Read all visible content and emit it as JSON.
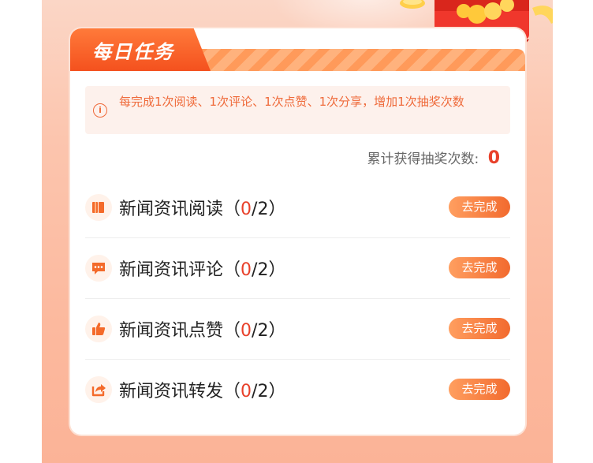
{
  "card": {
    "title": "每日任务",
    "notice": "每完成1次阅读、1次评论、1次点赞、1次分享，增加1次抽奖次数",
    "total_label": "累计获得抽奖次数:",
    "total_value": "0"
  },
  "tasks": [
    {
      "icon": "book-icon",
      "name": "新闻资讯阅读",
      "open": "（",
      "done": "0",
      "rest": "/2）",
      "button": "去完成"
    },
    {
      "icon": "comment-icon",
      "name": "新闻资讯评论",
      "open": "（",
      "done": "0",
      "rest": "/2）",
      "button": "去完成"
    },
    {
      "icon": "thumbs-up-icon",
      "name": "新闻资讯点赞",
      "open": "（",
      "done": "0",
      "rest": "/2）",
      "button": "去完成"
    },
    {
      "icon": "share-icon",
      "name": "新闻资讯转发",
      "open": "（",
      "done": "0",
      "rest": "/2）",
      "button": "去完成"
    }
  ],
  "colors": {
    "accent": "#f4511e",
    "count": "#e8402a",
    "button_start": "#ff9f60",
    "button_end": "#f26a2e"
  }
}
